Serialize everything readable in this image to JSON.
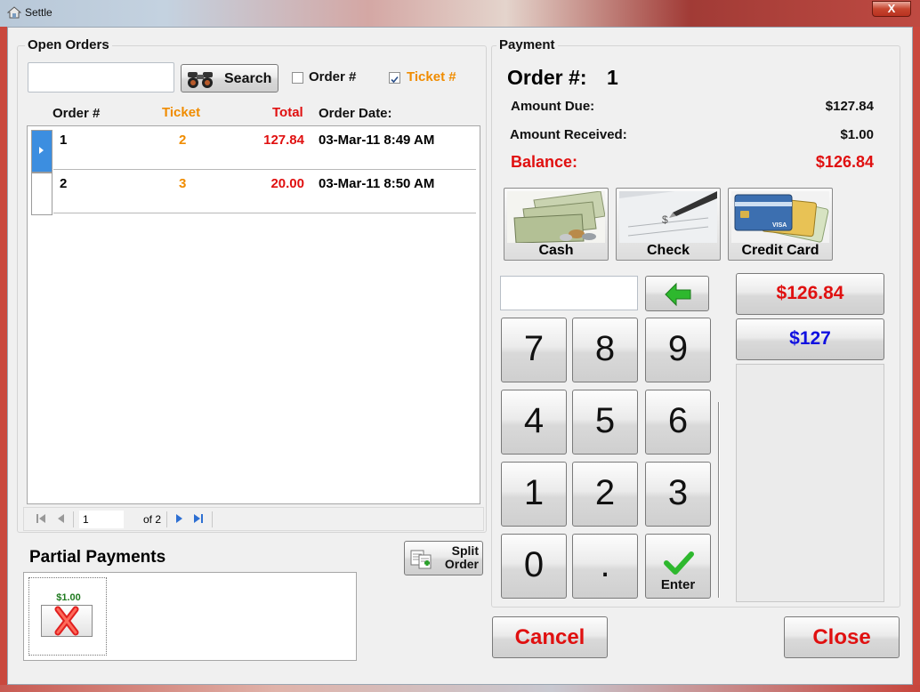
{
  "window": {
    "title": "Settle",
    "close_glyph": "X"
  },
  "colors": {
    "ticket": "#f08c00",
    "total": "#e01010",
    "balance": "#e01010",
    "quick_exact": "#e01010",
    "quick_round": "#1010e0",
    "cancel_close": "#e01010"
  },
  "open_orders": {
    "title": "Open Orders",
    "search": {
      "value": "",
      "button_label": "Search"
    },
    "filters": [
      {
        "label": "Order #",
        "checked": false
      },
      {
        "label": "Ticket #",
        "checked": true
      }
    ],
    "columns": {
      "order": "Order #",
      "ticket": "Ticket",
      "total": "Total",
      "date": "Order Date:"
    },
    "rows": [
      {
        "order": "1",
        "ticket": "2",
        "total": "127.84",
        "date": "03-Mar-11 8:49 AM",
        "selected": true
      },
      {
        "order": "2",
        "ticket": "3",
        "total": "20.00",
        "date": "03-Mar-11 8:50 AM",
        "selected": false
      }
    ],
    "navigator": {
      "page": "1",
      "of_text": "of 2"
    }
  },
  "partial_payments": {
    "title": "Partial Payments",
    "split_label_1": "Split",
    "split_label_2": "Order",
    "items": [
      {
        "amount": "$1.00"
      }
    ]
  },
  "payment": {
    "title": "Payment",
    "order_label": "Order #:",
    "order_value": "1",
    "amount_due_label": "Amount Due:",
    "amount_due": "$127.84",
    "amount_received_label": "Amount Received:",
    "amount_received": "$1.00",
    "balance_label": "Balance:",
    "balance": "$126.84",
    "tenders": [
      {
        "label": "Cash"
      },
      {
        "label": "Check"
      },
      {
        "label": "Credit Card"
      }
    ],
    "entry_value": "",
    "keys": [
      "7",
      "8",
      "9",
      "4",
      "5",
      "6",
      "1",
      "2",
      "3",
      "0",
      "."
    ],
    "enter_label": "Enter",
    "quick_amounts": [
      "$126.84",
      "$127"
    ],
    "cancel_label": "Cancel",
    "close_label": "Close"
  }
}
